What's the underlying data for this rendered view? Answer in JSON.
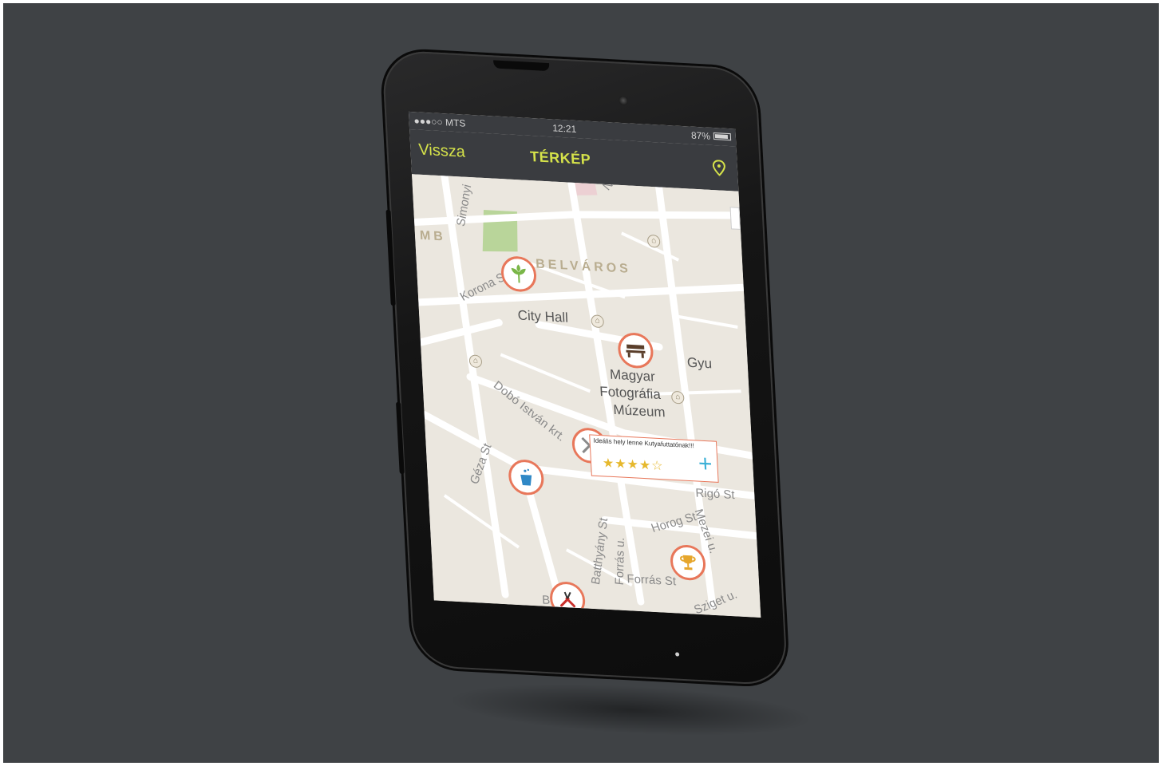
{
  "status_bar": {
    "carrier": "●●●○○ MTS",
    "time": "12:21",
    "battery": "87%"
  },
  "nav": {
    "back_label": "Vissza",
    "title": "TÉRKÉP"
  },
  "map": {
    "district": "BELVÁROS",
    "places": {
      "city_hall": "City Hall",
      "museum": [
        "Magyar",
        "Fotográfia",
        "Múzeum"
      ]
    },
    "streets": {
      "simonyi": "Simonyi",
      "korona": "Korona St",
      "dobo": "Dobó István krt.",
      "geza": "Géza St",
      "batthyany": "Batthyány St",
      "forras_u": "Forrás u.",
      "forras_st": "Forrás St",
      "horog": "Horog St",
      "mezei": "Mezei u.",
      "rigo": "Rigó St",
      "sziget": "Sziget u.",
      "burg": "Burg",
      "gyu": "Gyu",
      "mb": "MB",
      "nag": "Nag"
    }
  },
  "callout": {
    "text": "Ideális hely lenne Kutyafuttatónak!!!",
    "rating": 4.5,
    "stars": "★★★★☆",
    "add_label": "+"
  },
  "colors": {
    "accent": "#d6e34a",
    "poi_border": "#e8775a",
    "add": "#3bb0d6",
    "star": "#e6b82c"
  }
}
